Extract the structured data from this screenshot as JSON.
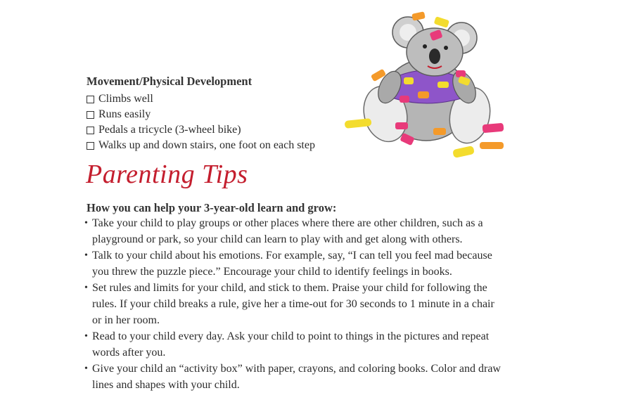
{
  "movement": {
    "heading": "Movement/Physical Development",
    "items": [
      "Climbs well",
      "Runs easily",
      "Pedals a tricycle (3-wheel bike)",
      "Walks up and down stairs, one foot on each step"
    ]
  },
  "tips": {
    "title": "Parenting Tips",
    "subheading": "How you can help your 3-year-old learn and grow:",
    "items": [
      "Take your child to play groups or other places where there are other children, such as a playground or park, so your child can learn to play with and get along with others.",
      "Talk to your child about his emotions. For example, say, “I can tell you feel mad because you threw the puzzle piece.” Encourage your child to identify feelings in books.",
      "Set rules and limits for your child, and stick to them. Praise your child for following the rules. If your child breaks a rule, give her a time-out for 30 seconds to 1 minute in a chair or in her room.",
      "Read to your child every day. Ask your child to point to things in the pictures and repeat words after you.",
      "Give your child an “activity box” with paper, crayons, and coloring books. Color and draw lines and shapes with your child."
    ]
  },
  "illustration": {
    "name": "koala-with-puzzle-pieces",
    "colors": {
      "accent_red": "#c41e2e",
      "koala_gray": "#9a9a9a",
      "shirt_purple": "#8e55c9",
      "piece_yellow": "#f3dc2e",
      "piece_pink": "#e83a7a",
      "piece_orange": "#f49a2a"
    }
  }
}
